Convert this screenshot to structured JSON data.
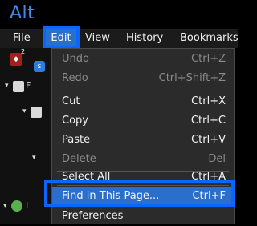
{
  "app_title": "Alt",
  "menubar": {
    "file": "File",
    "edit": "Edit",
    "view": "View",
    "history": "History",
    "bookmarks": "Bookmarks"
  },
  "toolbar": {
    "ublock_count": "2",
    "ublock_icon": "ublock-icon",
    "s_icon": "s-extension-icon"
  },
  "tree": {
    "rows": [
      {
        "arrow": "▾",
        "icon": "folder-icon",
        "label": "F"
      },
      {
        "arrow": "▾",
        "icon": "folder-icon",
        "label": ""
      },
      {
        "arrow": "▾",
        "icon": "folder-icon",
        "label": ""
      },
      {
        "arrow": "▾",
        "icon": "green-icon",
        "label": "L"
      }
    ]
  },
  "edit_menu": {
    "items": [
      {
        "label": "Undo",
        "shortcut": "Ctrl+Z",
        "enabled": false
      },
      {
        "label": "Redo",
        "shortcut": "Ctrl+Shift+Z",
        "enabled": false
      },
      {
        "label": "Cut",
        "shortcut": "Ctrl+X",
        "enabled": true
      },
      {
        "label": "Copy",
        "shortcut": "Ctrl+C",
        "enabled": true
      },
      {
        "label": "Paste",
        "shortcut": "Ctrl+V",
        "enabled": true
      },
      {
        "label": "Delete",
        "shortcut": "Del",
        "enabled": false
      },
      {
        "label": "Select All",
        "shortcut": "Ctrl+A",
        "enabled": true
      },
      {
        "label": "Find in This Page...",
        "shortcut": "Ctrl+F",
        "enabled": true,
        "highlighted": true
      },
      {
        "label": "Preferences",
        "shortcut": "",
        "enabled": true
      }
    ]
  },
  "colors": {
    "title": "#3f8ce8",
    "highlight": "#2a6fcc",
    "callout_border": "#0a66ff"
  }
}
